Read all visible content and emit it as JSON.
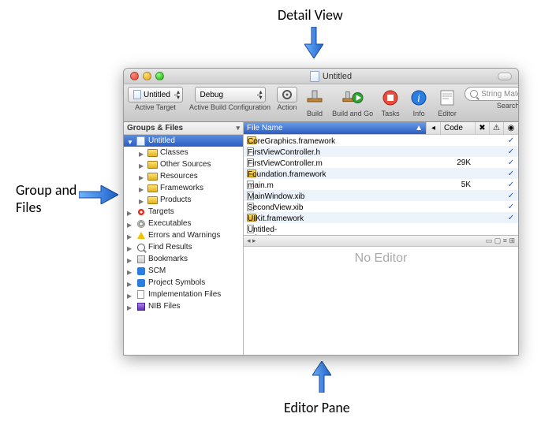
{
  "annotations": {
    "detail_view": "Detail View",
    "groups_files_l1": "Group and",
    "groups_files_l2": "Files",
    "editor_pane": "Editor Pane"
  },
  "window": {
    "title": "Untitled"
  },
  "toolbar": {
    "active_target": {
      "label": "Active Target",
      "value": "Untitled"
    },
    "build_config": {
      "label": "Active Build Configuration",
      "value": "Debug"
    },
    "action": "Action",
    "build": "Build",
    "build_and_go": "Build and Go",
    "tasks": "Tasks",
    "info": "Info",
    "editor": "Editor",
    "search_label": "Search",
    "search_placeholder": "String Matching"
  },
  "sidebar": {
    "header": "Groups & Files",
    "root": "Untitled",
    "items": [
      {
        "label": "Classes"
      },
      {
        "label": "Other Sources"
      },
      {
        "label": "Resources"
      },
      {
        "label": "Frameworks"
      },
      {
        "label": "Products"
      }
    ],
    "extra": [
      {
        "label": "Targets"
      },
      {
        "label": "Executables"
      },
      {
        "label": "Errors and Warnings"
      },
      {
        "label": "Find Results"
      },
      {
        "label": "Bookmarks"
      },
      {
        "label": "SCM"
      },
      {
        "label": "Project Symbols"
      },
      {
        "label": "Implementation Files"
      },
      {
        "label": "NIB Files"
      }
    ]
  },
  "detail": {
    "columns": {
      "file_name": "File Name",
      "code": "Code"
    },
    "rows": [
      {
        "name": "CoreGraphics.framework",
        "code": "",
        "kind": "fw",
        "check": true
      },
      {
        "name": "FirstViewController.h",
        "code": "",
        "kind": "h",
        "check": true
      },
      {
        "name": "FirstViewController.m",
        "code": "29K",
        "kind": "m",
        "check": true
      },
      {
        "name": "Foundation.framework",
        "code": "",
        "kind": "fw",
        "check": true
      },
      {
        "name": "main.m",
        "code": "5K",
        "kind": "m",
        "check": true
      },
      {
        "name": "MainWindow.xib",
        "code": "",
        "kind": "h",
        "check": true
      },
      {
        "name": "SecondView.xib",
        "code": "",
        "kind": "h",
        "check": true
      },
      {
        "name": "UIKit.framework",
        "code": "",
        "kind": "fw",
        "check": true
      },
      {
        "name": "Untitled-Info.plist",
        "code": "",
        "kind": "h",
        "check": false
      }
    ]
  },
  "editor": {
    "placeholder": "No Editor"
  }
}
